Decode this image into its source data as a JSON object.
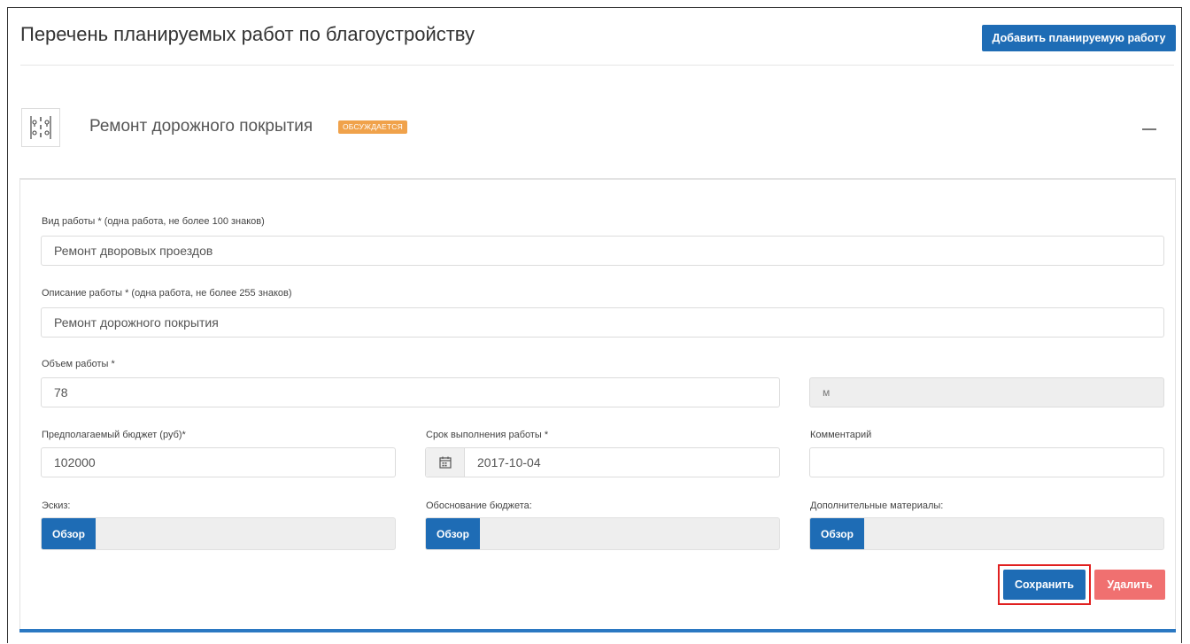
{
  "header": {
    "title": "Перечень планируемых работ по благоустройству",
    "add_button": "Добавить планируемую работу"
  },
  "card": {
    "title": "Ремонт дорожного покрытия",
    "status": "ОБСУЖДАЕТСЯ",
    "collapse_icon": "minus-icon",
    "icon": "road-marking-icon"
  },
  "form": {
    "work_type": {
      "label": "Вид работы * (одна работа, не более 100 знаков)",
      "value": "Ремонт дворовых проездов"
    },
    "description": {
      "label": "Описание работы * (одна работа, не более 255 знаков)",
      "value": "Ремонт дорожного покрытия"
    },
    "volume": {
      "label": "Объем работы *",
      "value": "78",
      "unit": "м"
    },
    "budget": {
      "label": "Предполагаемый бюджет (руб)*",
      "value": "102000"
    },
    "deadline": {
      "label": "Срок выполнения работы *",
      "value": "2017-10-04",
      "icon": "calendar-icon"
    },
    "comment": {
      "label": "Комментарий",
      "value": ""
    },
    "sketch": {
      "label": "Эскиз:",
      "button": "Обзор"
    },
    "budget_justification": {
      "label": "Обоснование бюджета:",
      "button": "Обзор"
    },
    "extra_materials": {
      "label": "Дополнительные материалы:",
      "button": "Обзор"
    }
  },
  "actions": {
    "save": "Сохранить",
    "delete": "Удалить"
  },
  "colors": {
    "primary": "#1e6cb5",
    "danger": "#f07070",
    "badge": "#f0a24b",
    "highlight": "#e02020"
  }
}
